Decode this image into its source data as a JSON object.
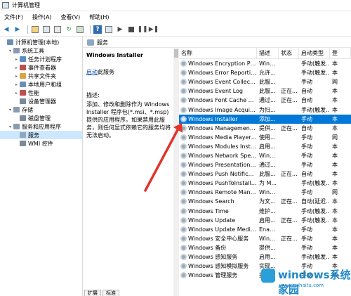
{
  "window": {
    "title": "计算机管理"
  },
  "menu": [
    "文件(F)",
    "操作(A)",
    "查看(V)",
    "帮助(H)"
  ],
  "tree": [
    {
      "label": "计算机管理(本地)",
      "indent": 0,
      "arrow": "",
      "color": "#6a8fb5"
    },
    {
      "label": "系统工具",
      "indent": 1,
      "arrow": "v",
      "color": "#8a9bb0"
    },
    {
      "label": "任务计划程序",
      "indent": 2,
      "arrow": ">",
      "color": "#5b8ec4"
    },
    {
      "label": "事件查看器",
      "indent": 2,
      "arrow": ">",
      "color": "#c0504d"
    },
    {
      "label": "共享文件夹",
      "indent": 2,
      "arrow": ">",
      "color": "#d9a441"
    },
    {
      "label": "本地用户和组",
      "indent": 2,
      "arrow": ">",
      "color": "#6a8fb5"
    },
    {
      "label": "性能",
      "indent": 2,
      "arrow": ">",
      "color": "#c0504d"
    },
    {
      "label": "设备管理器",
      "indent": 2,
      "arrow": "",
      "color": "#7a8a99"
    },
    {
      "label": "存储",
      "indent": 1,
      "arrow": "v",
      "color": "#8a9bb0"
    },
    {
      "label": "磁盘管理",
      "indent": 2,
      "arrow": "",
      "color": "#7a8a99"
    },
    {
      "label": "服务和应用程序",
      "indent": 1,
      "arrow": "v",
      "color": "#8a9bb0"
    },
    {
      "label": "服务",
      "indent": 2,
      "arrow": "",
      "color": "#8fa8c2",
      "selected": true
    },
    {
      "label": "WMI 控件",
      "indent": 2,
      "arrow": "",
      "color": "#7a8a99"
    }
  ],
  "breadcrumb": "服务",
  "details": {
    "service_name": "Windows Installer",
    "action_link": "启动",
    "action_rest": "此服务",
    "desc_title": "描述:",
    "desc_text": "添加、修改和删除作为 Windows Installer 程序包(*.msi、*.msp)提供的应用程序。如果禁用此服务，则任何显式依赖它的服务均将无法启动。"
  },
  "tabs": [
    "扩展",
    "标准"
  ],
  "columns": [
    "名称",
    "描述",
    "状态",
    "启动类型",
    "登"
  ],
  "services": [
    {
      "name": "Windows Encryption Pro...",
      "desc": "Win...",
      "status": "",
      "start": "手动(触发...",
      "log": "本"
    },
    {
      "name": "Windows Error Reportin...",
      "desc": "允许...",
      "status": "",
      "start": "手动(触发...",
      "log": "本"
    },
    {
      "name": "Windows Event Collector",
      "desc": "此服...",
      "status": "",
      "start": "手动",
      "log": "网"
    },
    {
      "name": "Windows Event Log",
      "desc": "此服...",
      "status": "正在...",
      "start": "自动",
      "log": "本"
    },
    {
      "name": "Windows Font Cache Ser...",
      "desc": "通过...",
      "status": "正在...",
      "start": "自动",
      "log": "本"
    },
    {
      "name": "Windows Image Acquisiti...",
      "desc": "为扫...",
      "status": "",
      "start": "手动(触发...",
      "log": "本"
    },
    {
      "name": "Windows Installer",
      "desc": "添加...",
      "status": "",
      "start": "手动",
      "log": "本",
      "selected": true
    },
    {
      "name": "Windows Management I...",
      "desc": "提供...",
      "status": "正在...",
      "start": "自动",
      "log": "本"
    },
    {
      "name": "Windows Media Player N...",
      "desc": "使用...",
      "status": "",
      "start": "手动",
      "log": "网"
    },
    {
      "name": "Windows Modules Install...",
      "desc": "启用...",
      "status": "",
      "start": "手动",
      "log": "本"
    },
    {
      "name": "Windows Network Spee...",
      "desc": "Win...",
      "status": "",
      "start": "手动",
      "log": "本"
    },
    {
      "name": "Windows Presentation Fo...",
      "desc": "通过...",
      "status": "",
      "start": "手动",
      "log": "本"
    },
    {
      "name": "Windows Push Notificati...",
      "desc": "此服...",
      "status": "正在...",
      "start": "自动",
      "log": "本"
    },
    {
      "name": "Windows PushToInstall ...",
      "desc": "为 M...",
      "status": "",
      "start": "手动(触发...",
      "log": "本"
    },
    {
      "name": "Windows Remote Manag...",
      "desc": "Win...",
      "status": "",
      "start": "手动",
      "log": "网"
    },
    {
      "name": "Windows Search",
      "desc": "为文...",
      "status": "正在...",
      "start": "自动(延迟...",
      "log": "本"
    },
    {
      "name": "Windows Time",
      "desc": "维护...",
      "status": "",
      "start": "手动(触发...",
      "log": "本"
    },
    {
      "name": "Windows Update",
      "desc": "启用...",
      "status": "正在...",
      "start": "手动(触发...",
      "log": "本"
    },
    {
      "name": "Windows Update Medic ...",
      "desc": "Ena...",
      "status": "",
      "start": "手动",
      "log": "本"
    },
    {
      "name": "Windows 安全中心服务",
      "desc": "Win...",
      "status": "正在...",
      "start": "手动",
      "log": "本"
    },
    {
      "name": "Windows 备份",
      "desc": "提供...",
      "status": "",
      "start": "手动",
      "log": "本"
    },
    {
      "name": "Windows 感知服务",
      "desc": "启用...",
      "status": "",
      "start": "手动(触发...",
      "log": "本"
    },
    {
      "name": "Windows 感知模拟服务",
      "desc": "实现...",
      "status": "",
      "start": "手动",
      "log": "本"
    },
    {
      "name": "Windows 管理服务",
      "desc": "执行...",
      "status": "",
      "start": "手动",
      "log": "本"
    }
  ],
  "watermark": {
    "title": "windows系统家园",
    "sub": "www.ruihaitu.com"
  },
  "colors": {
    "selection": "#0078d7",
    "arrow": "#e0352b",
    "watermark": "#1e88c8"
  }
}
